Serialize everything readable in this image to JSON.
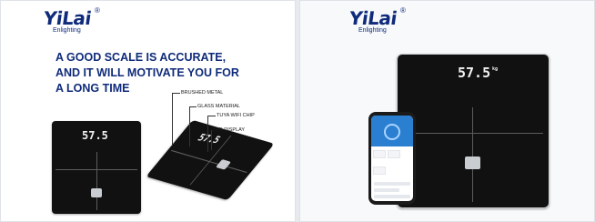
{
  "left_panel": {
    "logo": {
      "name": "YiLai",
      "reg": "®",
      "sub": "Enlighting"
    },
    "headline": [
      "A GOOD SCALE IS ACCURATE,",
      "AND IT WILL MOTIVATE YOU FOR",
      "A LONG TIME"
    ],
    "features": [
      "BRUSHED METAL",
      "GLASS MATERIAL",
      "TUYA WIFI CHIP",
      "LED DISPLAY"
    ],
    "front_scale_reading": "57.5",
    "angled_scale_reading": "57.5"
  },
  "right_panel": {
    "logo": {
      "name": "YiLai",
      "reg": "®",
      "sub": "Enlighting"
    },
    "scale_reading": "57.5",
    "scale_unit": "kg"
  },
  "colors": {
    "brand": "#0f2b7a",
    "scale_glass": "#111111",
    "app_blue": "#2b7fd0"
  }
}
